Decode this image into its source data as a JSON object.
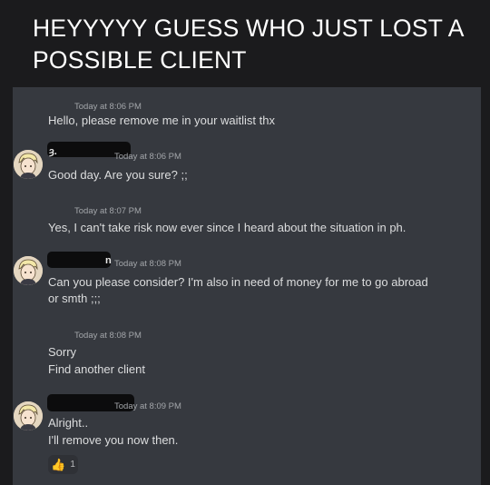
{
  "caption": {
    "line1": "HEYYYYY GUESS WHO JUST LOST A",
    "line2": "POSSIBLE CLIENT"
  },
  "messages": [
    {
      "timestamp": "Today at 8:06 PM",
      "lines": [
        "Hello, please remove me in your waitlist thx"
      ]
    },
    {
      "name_fragment": "ȝ.",
      "timestamp": "Today at 8:06 PM",
      "lines": [
        "Good day. Are you sure? ;;"
      ]
    },
    {
      "timestamp": "Today at 8:07 PM",
      "lines": [
        "Yes, I can't take risk now ever since I heard about the situation in ph."
      ]
    },
    {
      "name_fragment": "n",
      "timestamp": "Today at 8:08 PM",
      "lines": [
        "Can you please consider? I'm also in need of money for me to go abroad",
        "or smth ;;;"
      ]
    },
    {
      "timestamp": "Today at 8:08 PM",
      "lines": [
        "Sorry",
        "Find another client"
      ]
    },
    {
      "timestamp": "Today at 8:09 PM",
      "lines": [
        "Alright..",
        "I'll remove you now then."
      ]
    }
  ],
  "reaction": {
    "icon": "thumbs-up-icon",
    "emoji": "👍",
    "count": "1"
  },
  "colors": {
    "background": "#36393f",
    "text": "#dcddde",
    "timestamp": "#a3a6aa"
  }
}
